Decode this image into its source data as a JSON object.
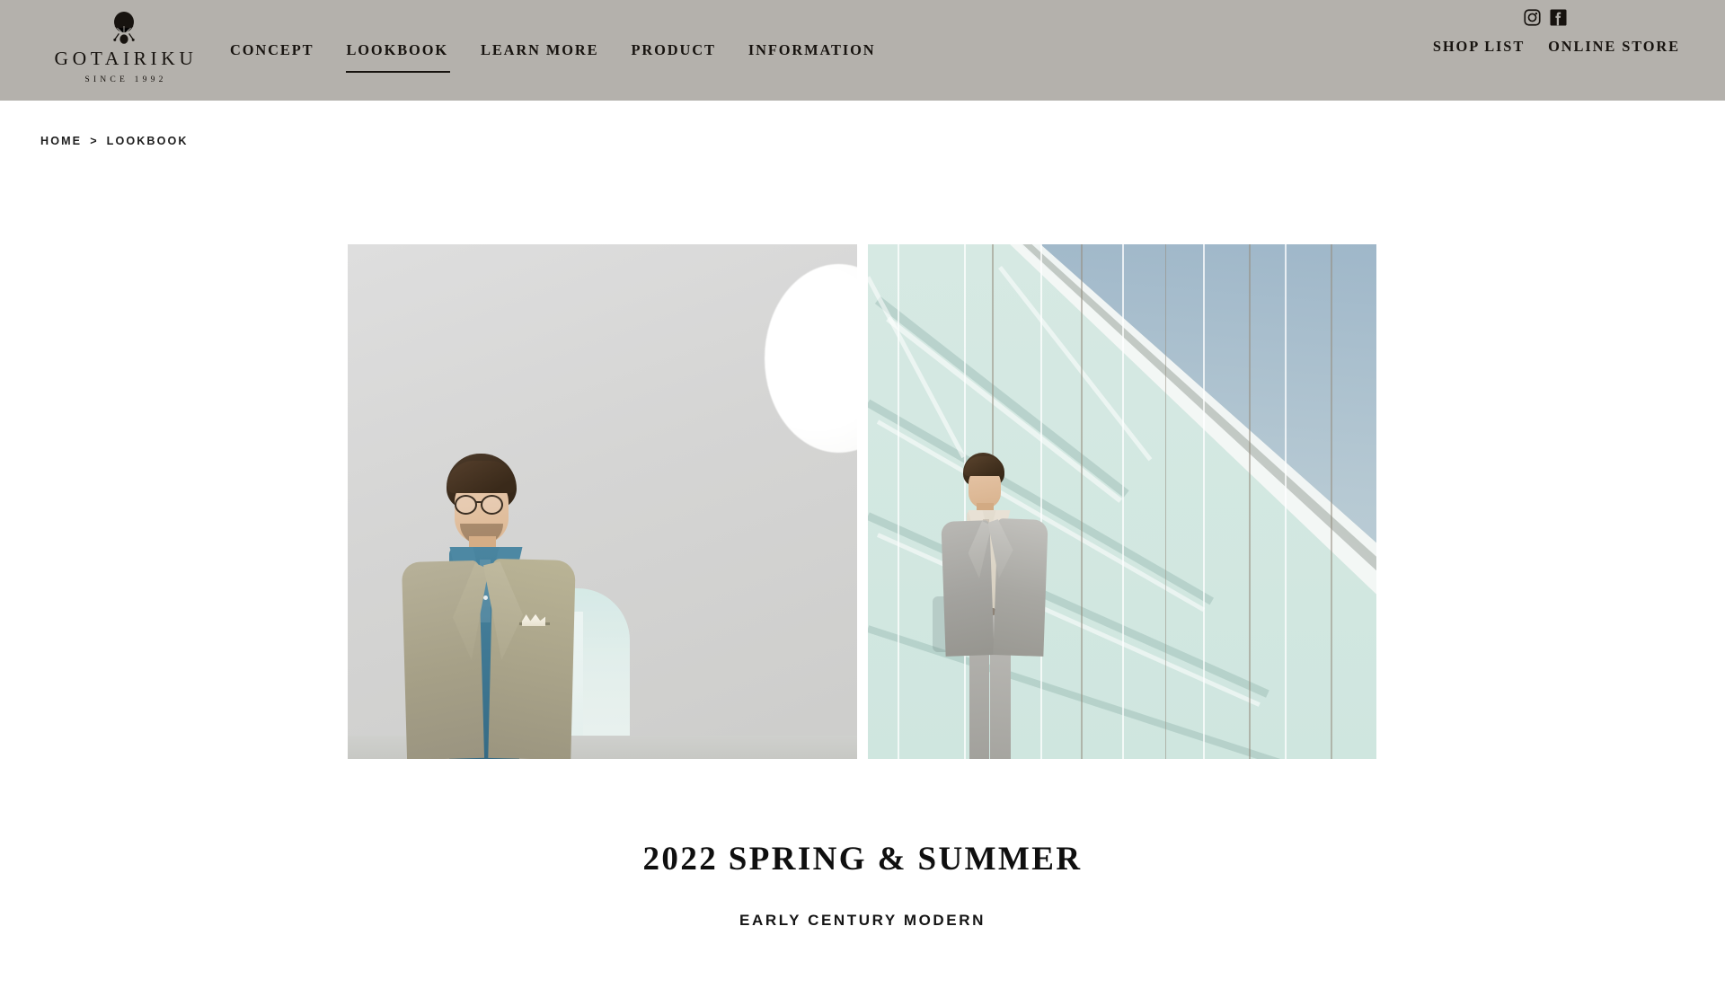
{
  "header": {
    "logo": {
      "icon": "hot-air-balloon-icon",
      "wordmark": "GOTAIRIKU",
      "tagline": "SINCE 1992"
    },
    "nav": [
      {
        "label": "CONCEPT",
        "active": false
      },
      {
        "label": "LOOKBOOK",
        "active": true
      },
      {
        "label": "LEARN MORE",
        "active": false
      },
      {
        "label": "PRODUCT",
        "active": false
      },
      {
        "label": "INFORMATION",
        "active": false
      }
    ],
    "social": [
      {
        "name": "instagram-icon",
        "label": "Instagram"
      },
      {
        "name": "facebook-icon",
        "label": "Facebook"
      }
    ],
    "util_nav": [
      {
        "label": "SHOP LIST"
      },
      {
        "label": "ONLINE STORE"
      }
    ],
    "background_color": "#b4b1ac"
  },
  "breadcrumb": {
    "home": "HOME",
    "separator": ">",
    "current": "LOOKBOOK"
  },
  "hero": {
    "images": [
      {
        "name": "lookbook-photo-left",
        "alt": "Man in olive linen jacket and teal polo shirt standing in a bright white gallery interior"
      },
      {
        "name": "lookbook-photo-right",
        "alt": "Man in light grey suit leaning against a pale green glass facade under blue sky"
      }
    ]
  },
  "caption": {
    "title": "2022 SPRING & SUMMER",
    "subtitle": "EARLY CENTURY MODERN"
  },
  "colors": {
    "header_bg": "#b4b1ac",
    "text": "#17130f",
    "page_bg": "#ffffff"
  }
}
